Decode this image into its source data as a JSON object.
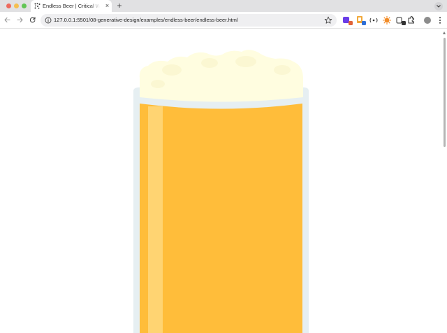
{
  "tab": {
    "title": "Endless Beer | Critical Web Design",
    "close_glyph": "×"
  },
  "tabstrip": {
    "new_tab_glyph": "+"
  },
  "toolbar": {
    "url": "127.0.0.1:5501/08-generative-design/examples/endless-beer/endless-beer.html"
  },
  "icons": {
    "back": "arrow-left-icon",
    "forward": "arrow-right-icon",
    "reload": "reload-icon",
    "site_info": "info-icon",
    "bookmark": "star-icon",
    "menu": "kebab-menu-icon",
    "tab_list": "chevron-down-icon"
  },
  "colors": {
    "beer": "#ffbd3a",
    "foam": "#fffde0",
    "glass": "#e6eff2",
    "highlight": "#ffd679",
    "tabstrip": "#e1e1e3",
    "omnibox": "#efeff1"
  }
}
